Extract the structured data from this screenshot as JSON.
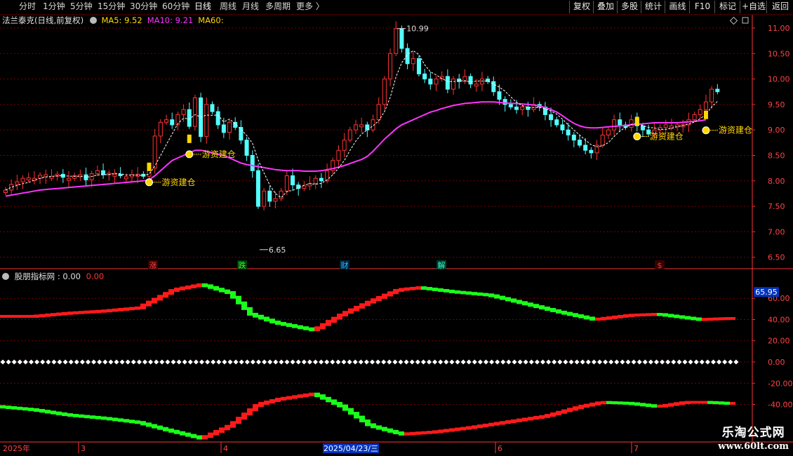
{
  "toolbar": {
    "periods": [
      "分时",
      "1分钟",
      "5分钟",
      "15分钟",
      "30分钟",
      "60分钟",
      "日线",
      "周线",
      "月线",
      "多周期",
      "更多 〉"
    ],
    "active_period": "日线",
    "actions": [
      "复权",
      "叠加",
      "多股",
      "统计",
      "画线",
      "F10",
      "标记",
      "+自选",
      "返回"
    ]
  },
  "stock": {
    "name": "法兰泰克(日线,前复权)"
  },
  "ma": [
    {
      "label": "MA5: ",
      "value": "9.52",
      "color": "#ffd700"
    },
    {
      "label": "MA10: ",
      "value": "9.21",
      "color": "#ff33ff"
    },
    {
      "label": "MA60:",
      "value": "",
      "color": "#ffd700"
    }
  ],
  "price_axis": {
    "labels": [
      "11.00",
      "10.50",
      "10.00",
      "9.50",
      "9.00",
      "8.50",
      "8.00",
      "7.50",
      "7.00",
      "6.50"
    ],
    "values": [
      11,
      10.5,
      10,
      9.5,
      9,
      8.5,
      8,
      7.5,
      7,
      6.5
    ]
  },
  "annotations": {
    "high": "10.99",
    "low": "6.65",
    "signal": "游资建仓"
  },
  "event_marks": [
    {
      "text": "涨",
      "color": "#ff4444"
    },
    {
      "text": "跌",
      "color": "#33ff33"
    },
    {
      "text": "财",
      "color": "#33bbff"
    },
    {
      "text": "解",
      "color": "#33ffcc"
    },
    {
      "text": "$",
      "color": "#ff3333"
    }
  ],
  "indicator": {
    "name": "股朋指标网",
    "value1": ": 0.00",
    "value2": "0.00",
    "current": "65.95",
    "axis_labels": [
      "60.00",
      "40.00",
      "20.00",
      "0.00",
      "-20.00",
      "-40.00"
    ],
    "axis_values": [
      60,
      40,
      20,
      0,
      -20,
      -40
    ]
  },
  "date_axis": {
    "year": "2025年",
    "m3": "3",
    "m4": "4",
    "cursor_date": "2025/04/23/三",
    "m6": "6",
    "m7": "7"
  },
  "watermark": {
    "line1": "乐淘公式网",
    "line2": "www.60lt.com"
  },
  "colors": {
    "up": "#ff3333",
    "down": "#54ffff",
    "ma5": "#ffffff",
    "ma10": "#ff33ff",
    "grid": "#7a0000",
    "axis": "#ff3333",
    "ind_up": "#ff1a1a",
    "ind_down": "#1aff1a",
    "signal": "#ffd700"
  },
  "chart_data": {
    "type": "candlestick",
    "close": [
      7.82,
      7.93,
      7.98,
      8.05,
      8.06,
      8.05,
      8.11,
      8.12,
      8.09,
      8.13,
      8.07,
      8.05,
      8.1,
      8.12,
      8.02,
      8.14,
      8.2,
      8.12,
      8.15,
      8.13,
      8.1,
      8.08,
      8.12,
      8.13,
      8.09,
      8.25,
      8.88,
      9.15,
      9.2,
      9.1,
      9.3,
      9.4,
      9.07,
      9.63,
      8.87,
      9.5,
      9.36,
      9.1,
      8.95,
      9.15,
      9.05,
      8.8,
      8.5,
      8.2,
      7.5,
      7.8,
      7.6,
      7.65,
      7.8,
      8.1,
      7.92,
      7.85,
      7.9,
      7.95,
      8.05,
      8.0,
      8.2,
      8.4,
      8.6,
      8.8,
      9.0,
      9.1,
      9.1,
      9.0,
      9.2,
      9.5,
      10.0,
      10.5,
      10.99,
      10.6,
      10.3,
      10.4,
      10.1,
      10.0,
      9.9,
      10.0,
      10.05,
      9.8,
      10.0,
      9.95,
      10.05,
      9.9,
      9.9,
      10.0,
      9.95,
      9.75,
      9.6,
      9.5,
      9.45,
      9.4,
      9.45,
      9.4,
      9.5,
      9.45,
      9.3,
      9.2,
      9.1,
      9.0,
      8.9,
      8.8,
      8.7,
      8.6,
      8.55,
      8.7,
      8.9,
      9.0,
      9.2,
      9.1,
      9.05,
      9.2,
      9.08,
      9.0,
      8.92,
      9.0,
      9.05,
      9.1,
      9.08,
      9.1,
      9.1,
      9.2,
      9.3,
      9.4,
      9.55,
      9.8,
      9.75
    ],
    "ma10": [
      7.7,
      7.72,
      7.74,
      7.76,
      7.78,
      7.8,
      7.82,
      7.83,
      7.84,
      7.85,
      7.86,
      7.87,
      7.88,
      7.89,
      7.9,
      7.91,
      7.92,
      7.93,
      7.94,
      7.95,
      7.96,
      7.97,
      7.98,
      7.99,
      8.0,
      8.02,
      8.1,
      8.2,
      8.3,
      8.4,
      8.45,
      8.5,
      8.55,
      8.6,
      8.6,
      8.58,
      8.55,
      8.52,
      8.5,
      8.45,
      8.4,
      8.35,
      8.32,
      8.3,
      8.28,
      8.26,
      8.24,
      8.22,
      8.21,
      8.2,
      8.2,
      8.2,
      8.19,
      8.19,
      8.19,
      8.2,
      8.22,
      8.24,
      8.27,
      8.3,
      8.34,
      8.38,
      8.42,
      8.48,
      8.58,
      8.7,
      8.82,
      8.92,
      9.02,
      9.1,
      9.15,
      9.2,
      9.25,
      9.3,
      9.35,
      9.38,
      9.42,
      9.45,
      9.48,
      9.5,
      9.52,
      9.53,
      9.54,
      9.55,
      9.55,
      9.55,
      9.54,
      9.53,
      9.52,
      9.52,
      9.51,
      9.5,
      9.49,
      9.47,
      9.44,
      9.4,
      9.35,
      9.28,
      9.2,
      9.13,
      9.08,
      9.05,
      9.04,
      9.04,
      9.05,
      9.06,
      9.07,
      9.08,
      9.09,
      9.1,
      9.11,
      9.12,
      9.13,
      9.14,
      9.14,
      9.14,
      9.14,
      9.14,
      9.15,
      9.16,
      9.17,
      9.18,
      9.2
    ]
  }
}
